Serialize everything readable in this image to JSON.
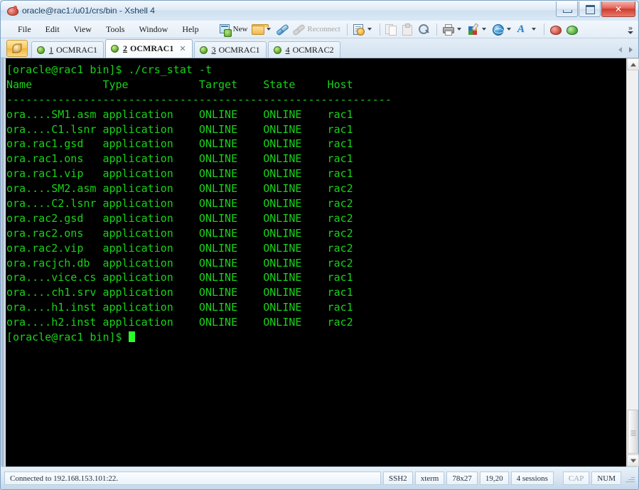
{
  "window": {
    "title": "oracle@rac1:/u01/crs/bin - Xshell 4",
    "app_icon": "xshell-icon",
    "minimize_label": "Minimize",
    "maximize_label": "Maximize",
    "close_label": "✕"
  },
  "menu": {
    "items": [
      {
        "label": "File"
      },
      {
        "label": "Edit"
      },
      {
        "label": "View"
      },
      {
        "label": "Tools"
      },
      {
        "label": "Window"
      },
      {
        "label": "Help"
      }
    ]
  },
  "toolbar": {
    "new_label": "New",
    "new_icon": "new-session-icon",
    "open_icon": "open-folder-icon",
    "connect_icon": "connect-plug-icon",
    "reconnect_label": "Reconnect",
    "reconnect_icon": "reconnect-plug-icon",
    "properties_icon": "properties-icon",
    "copy_icon": "copy-icon",
    "paste_icon": "paste-icon",
    "find_icon": "find-icon",
    "print_icon": "print-icon",
    "palette_icon": "color-palette-icon",
    "globe_icon": "globe-icon",
    "font_icon": "font-icon",
    "app1_icon": "xshell-app-icon",
    "app2_icon": "xftp-app-icon",
    "overflow_label": "»"
  },
  "tabbar": {
    "session_button_icon": "session-manager-icon",
    "tabs": [
      {
        "number": "1",
        "label": "OCMRAC1",
        "active": false,
        "status": "connected"
      },
      {
        "number": "2",
        "label": "OCMRAC1",
        "active": true,
        "status": "connected",
        "close_label": "✕"
      },
      {
        "number": "3",
        "label": "OCMRAC1",
        "active": false,
        "status": "connected"
      },
      {
        "number": "4",
        "label": "OCMRAC2",
        "active": false,
        "status": "connected"
      }
    ],
    "scroll_left_icon": "scroll-left-icon",
    "scroll_right_icon": "scroll-right-icon"
  },
  "terminal": {
    "foreground_color": "#19d219",
    "background_color": "#000000",
    "cursor_color": "#2bff2b",
    "lines": [
      "[oracle@rac1 bin]$ ./crs_stat -t",
      "Name           Type           Target    State     Host",
      "------------------------------------------------------------",
      "ora....SM1.asm application    ONLINE    ONLINE    rac1",
      "ora....C1.lsnr application    ONLINE    ONLINE    rac1",
      "ora.rac1.gsd   application    ONLINE    ONLINE    rac1",
      "ora.rac1.ons   application    ONLINE    ONLINE    rac1",
      "ora.rac1.vip   application    ONLINE    ONLINE    rac1",
      "ora....SM2.asm application    ONLINE    ONLINE    rac2",
      "ora....C2.lsnr application    ONLINE    ONLINE    rac2",
      "ora.rac2.gsd   application    ONLINE    ONLINE    rac2",
      "ora.rac2.ons   application    ONLINE    ONLINE    rac2",
      "ora.rac2.vip   application    ONLINE    ONLINE    rac2",
      "ora.racjch.db  application    ONLINE    ONLINE    rac2",
      "ora....vice.cs application    ONLINE    ONLINE    rac1",
      "ora....ch1.srv application    ONLINE    ONLINE    rac1",
      "ora....h1.inst application    ONLINE    ONLINE    rac1",
      "ora....h2.inst application    ONLINE    ONLINE    rac2"
    ],
    "prompt": "[oracle@rac1 bin]$ "
  },
  "scrollbar": {
    "up_icon": "scroll-up-icon",
    "down_icon": "scroll-down-icon",
    "thumb_name": "scroll-thumb"
  },
  "statusbar": {
    "connection": "Connected to 192.168.153.101:22.",
    "protocol": "SSH2",
    "term_type": "xterm",
    "dimensions": "78x27",
    "cursor_position": "19,20",
    "sessions": "4 sessions",
    "caps_lock": "CAP",
    "num_lock": "NUM"
  }
}
